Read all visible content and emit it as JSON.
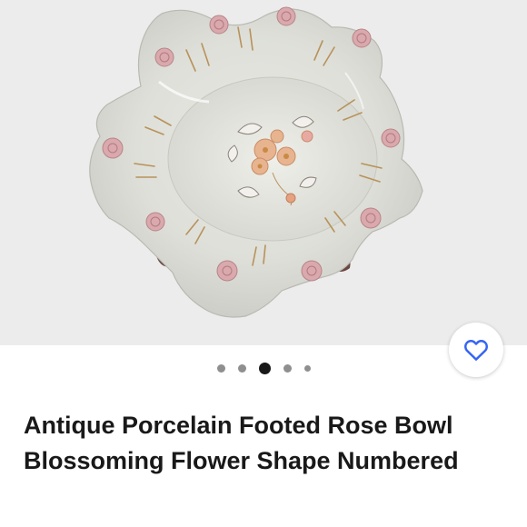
{
  "listing": {
    "title": "Antique Porcelain Footed Rose Bowl Blossoming Flower Shape Numbered"
  },
  "gallery": {
    "image_subject": "porcelain-rose-bowl",
    "current_index": 3,
    "total_images": 5
  },
  "favorite": {
    "icon": "heart-icon",
    "color": "#3665f3"
  },
  "colors": {
    "image_background": "#ececec",
    "dot_active": "#191919",
    "dot_inactive": "#8f8f8f",
    "title_text": "#191919"
  }
}
